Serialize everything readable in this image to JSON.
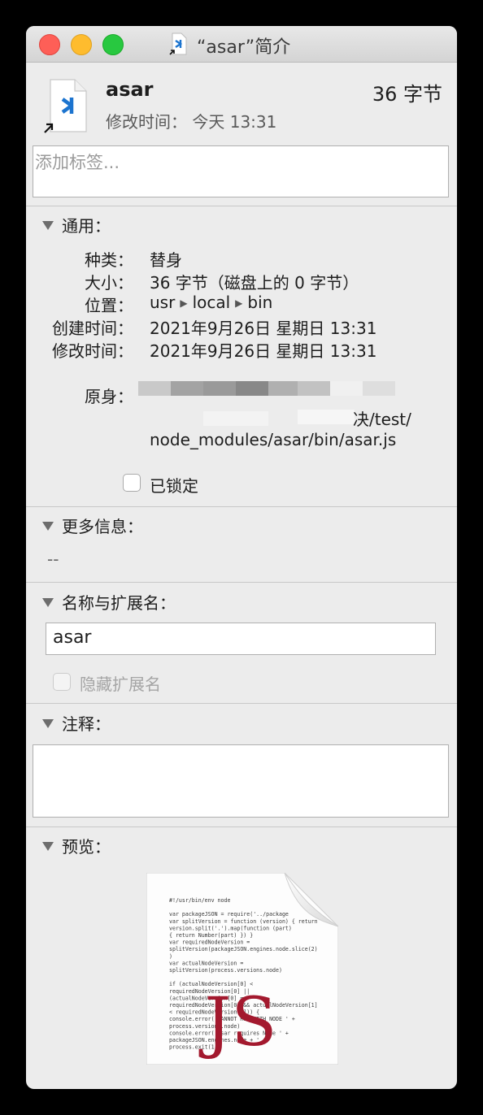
{
  "window": {
    "title": "“asar”简介"
  },
  "header": {
    "name": "asar",
    "size": "36 字节",
    "modified": "修改时间： 今天 13:31"
  },
  "tags": {
    "placeholder": "添加标签..."
  },
  "general": {
    "heading": "通用：",
    "rows": [
      {
        "label": "种类：",
        "value": "替身"
      },
      {
        "label": "大小：",
        "value": "36 字节（磁盘上的 0 字节）"
      },
      {
        "label": "位置：",
        "value": [
          "usr",
          "local",
          "bin"
        ]
      },
      {
        "label": "创建时间：",
        "value": "2021年9月26日 星期日 13:31"
      },
      {
        "label": "修改时间：",
        "value": "2021年9月26日 星期日 13:31"
      }
    ],
    "original_label": "原身：",
    "original_line2_tail": "决/test/",
    "original_line3": "node_modules/asar/bin/asar.js",
    "locked": "已锁定"
  },
  "more_info": {
    "heading": "更多信息：",
    "value": "--"
  },
  "name_ext": {
    "heading": "名称与扩展名：",
    "value": "asar",
    "hide_ext": "隐藏扩展名"
  },
  "comments": {
    "heading": "注释："
  },
  "preview": {
    "heading": "预览：",
    "code_lines": [
      "#!/usr/bin/env node",
      "",
      "var packageJSON = require('../package",
      "var splitVersion = function (version) { return",
      "version.split('.').map(function (part)",
      "{ return Number(part) }) }",
      "var requiredNodeVersion =",
      "splitVersion(packageJSON.engines.node.slice(2)",
      ")",
      "var actualNodeVersion =",
      "splitVersion(process.versions.node)",
      "",
      "if (actualNodeVersion[0] <",
      "requiredNodeVersion[0] ||",
      "(actualNodeVersion[0] ===",
      "requiredNodeVersion[0] && actualNodeVersion[1]",
      "< requiredNodeVersion[1])) {",
      "  console.error('CANNOT RUN WITH NODE ' +",
      "process.versions.node)",
      "  console.error('asar requires Node ' +",
      "packageJSON.engines.node + '.')",
      "  process.exit(1)"
    ],
    "badge": "JS"
  },
  "colors": {
    "vscode_blue": "#1c74cf",
    "js_red": "#a3192e"
  }
}
